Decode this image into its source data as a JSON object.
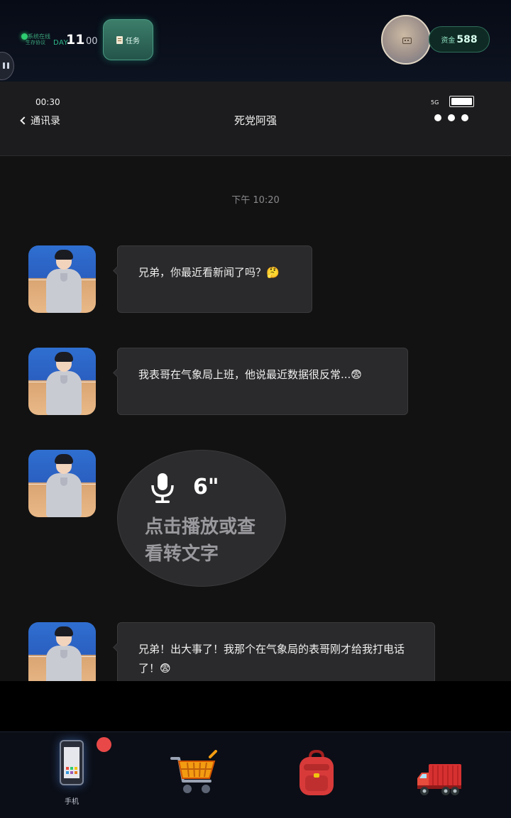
{
  "topbar": {
    "system_line1": "系统在线",
    "system_line2": "生存协议",
    "day_label": "DAY",
    "day_number": "11",
    "time": "00",
    "task_button": "任务",
    "funds_label": "资金",
    "funds_value": "588"
  },
  "phone": {
    "clock": "00:30",
    "signal": "5G",
    "battery_level": 1.0,
    "back_label": "通讯录",
    "contact_name": "死党阿强"
  },
  "chat": {
    "timestamp": "下午 10:20",
    "messages": [
      {
        "type": "text",
        "text": "兄弟，你最近看新闻了吗？🤔"
      },
      {
        "type": "text",
        "text": "我表哥在气象局上班，他说最近数据很反常...😨"
      },
      {
        "type": "voice",
        "duration": "6\"",
        "hint": "点击播放或查看转文字"
      },
      {
        "type": "text",
        "text": "兄弟！出大事了！我那个在气象局的表哥刚才给我打电话了！😨"
      }
    ]
  },
  "dock": {
    "phone_label": "手机"
  },
  "colors": {
    "accent_green": "#2ecc71",
    "notify_red": "#e84848",
    "bubble_bg": "#2a2a2c"
  }
}
